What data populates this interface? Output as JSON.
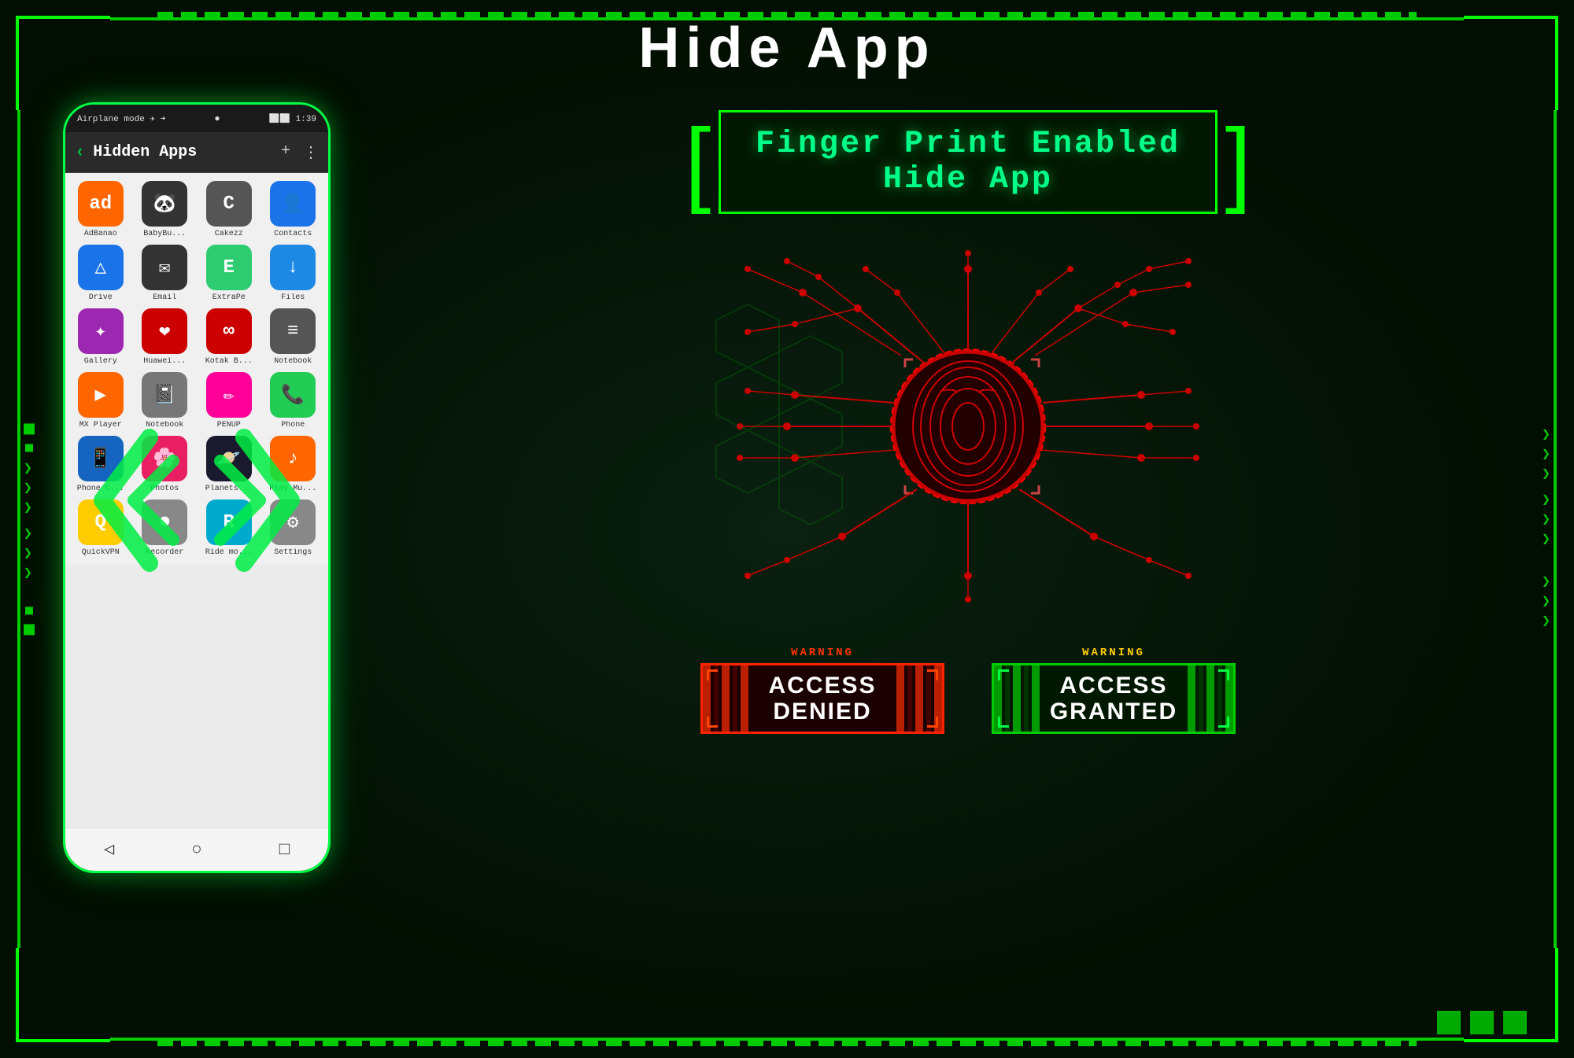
{
  "title": "Hide App",
  "phone": {
    "status_bar": {
      "left": "Airplane mode ✈ ➜",
      "center": "●",
      "right": "⬜⬜ 1:39"
    },
    "header": {
      "back": "‹",
      "title": "Hidden Apps",
      "add": "+",
      "menu": "⋮"
    },
    "apps": [
      {
        "label": "AdBanao",
        "color": "#ff6600",
        "text": "ad"
      },
      {
        "label": "BabyBu...",
        "color": "#333333",
        "text": "🐼"
      },
      {
        "label": "Cakezz",
        "color": "#555555",
        "text": "C"
      },
      {
        "label": "Contacts",
        "color": "#1a73e8",
        "text": "👤"
      },
      {
        "label": "Drive",
        "color": "#1a73e8",
        "text": "△"
      },
      {
        "label": "Email",
        "color": "#333333",
        "text": "✉"
      },
      {
        "label": "ExtraPe",
        "color": "#2ecc71",
        "text": "E"
      },
      {
        "label": "Files",
        "color": "#1e88e5",
        "text": "↓"
      },
      {
        "label": "Gallery",
        "color": "#9c27b0",
        "text": "✦"
      },
      {
        "label": "Huawei...",
        "color": "#cc0000",
        "text": "❤"
      },
      {
        "label": "Kotak B...",
        "color": "#cc0000",
        "text": "∞"
      },
      {
        "label": "Notebook",
        "color": "#555555",
        "text": "≡"
      },
      {
        "label": "MX Player",
        "color": "#ff6600",
        "text": "▶"
      },
      {
        "label": "Notebook",
        "color": "#777777",
        "text": "📓"
      },
      {
        "label": "PENUP",
        "color": "#ff0099",
        "text": "✏"
      },
      {
        "label": "Phone",
        "color": "#22cc55",
        "text": "📞"
      },
      {
        "label": "Phone C...",
        "color": "#1565c0",
        "text": "📱"
      },
      {
        "label": "Photos",
        "color": "#e91e63",
        "text": "🌸"
      },
      {
        "label": "Planets...",
        "color": "#1a1a2e",
        "text": "🪐"
      },
      {
        "label": "Play Mu...",
        "color": "#ff6600",
        "text": "♪"
      },
      {
        "label": "QuickVPN",
        "color": "#ffcc00",
        "text": "Q"
      },
      {
        "label": "Recorder",
        "color": "#888888",
        "text": "⏺"
      },
      {
        "label": "Ride mo...",
        "color": "#00aacc",
        "text": "R"
      },
      {
        "label": "Settings",
        "color": "#888888",
        "text": "⚙"
      }
    ],
    "nav": [
      "◁",
      "○",
      "□"
    ]
  },
  "fingerprint_title_line1": "Finger Print Enabled",
  "fingerprint_title_line2": "Hide App",
  "badges": {
    "denied": {
      "warning": "WARNING",
      "line1": "ACCESS",
      "line2": "DENIED"
    },
    "granted": {
      "warning": "WARNING",
      "line1": "ACCESS",
      "line2": "GRANTED"
    }
  },
  "bottom_squares": [
    "■",
    "■",
    "■"
  ],
  "icons": {
    "chevron_down": "❯",
    "bracket_left": "[",
    "bracket_right": "]"
  }
}
